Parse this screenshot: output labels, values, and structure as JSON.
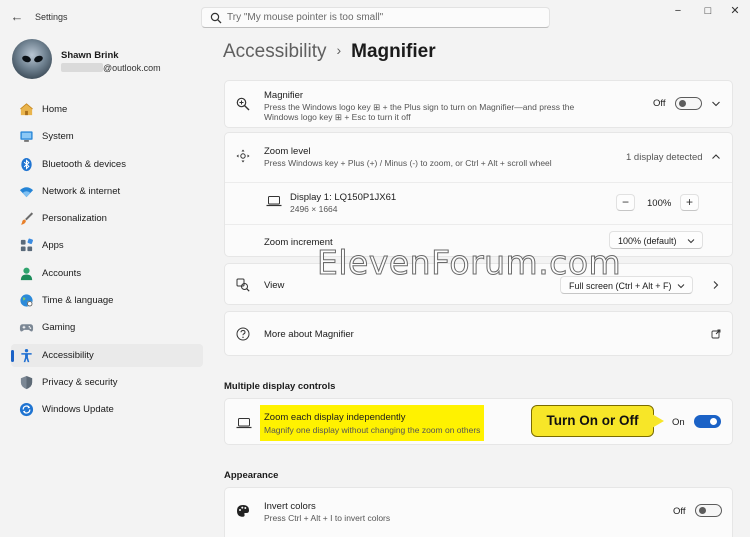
{
  "window": {
    "back_icon": "back-arrow-icon",
    "app_title": "Settings",
    "minimize_glyph": "−",
    "maximize_glyph": "□",
    "close_glyph": "✕"
  },
  "search": {
    "placeholder": "Try \"My mouse pointer is too small\""
  },
  "profile": {
    "name": "Shawn Brink",
    "email_suffix": "@outlook.com"
  },
  "sidebar": {
    "items": [
      {
        "label": "Home",
        "icon": "home-icon"
      },
      {
        "label": "System",
        "icon": "system-icon"
      },
      {
        "label": "Bluetooth & devices",
        "icon": "bluetooth-icon"
      },
      {
        "label": "Network & internet",
        "icon": "wifi-icon"
      },
      {
        "label": "Personalization",
        "icon": "brush-icon"
      },
      {
        "label": "Apps",
        "icon": "apps-icon"
      },
      {
        "label": "Accounts",
        "icon": "accounts-icon"
      },
      {
        "label": "Time & language",
        "icon": "globe-icon"
      },
      {
        "label": "Gaming",
        "icon": "gamepad-icon"
      },
      {
        "label": "Accessibility",
        "icon": "accessibility-icon",
        "active": true
      },
      {
        "label": "Privacy & security",
        "icon": "shield-icon"
      },
      {
        "label": "Windows Update",
        "icon": "update-icon"
      }
    ]
  },
  "breadcrumb": {
    "parent": "Accessibility",
    "separator": "›",
    "current": "Magnifier"
  },
  "magnifier": {
    "title": "Magnifier",
    "desc_line1": "Press the Windows logo key ⊞ + the Plus sign to turn on Magnifier—and press the",
    "desc_line2": "Windows logo key ⊞ + Esc to turn it off",
    "state": "Off",
    "toggle_on": false
  },
  "zoom_level": {
    "title": "Zoom level",
    "desc": "Press Windows key + Plus (+) / Minus (-) to zoom, or Ctrl + Alt + scroll wheel",
    "detected": "1 display detected"
  },
  "display": {
    "name": "Display 1: LQ150P1JX61",
    "resolution": "2496 × 1664",
    "minus": "−",
    "zoom_value": "100%",
    "plus": "+"
  },
  "zoom_increment": {
    "label": "Zoom increment",
    "value": "100% (default)"
  },
  "view": {
    "title": "View",
    "value": "Full screen (Ctrl + Alt + F)"
  },
  "more_about": {
    "title": "More about Magnifier"
  },
  "multiple_display": {
    "heading": "Multiple display controls",
    "title": "Zoom each display independently",
    "desc": "Magnify one display without changing the zoom on others",
    "state": "On",
    "toggle_on": true
  },
  "callout": {
    "text": "Turn On or Off"
  },
  "appearance": {
    "heading": "Appearance",
    "invert_title": "Invert colors",
    "invert_desc": "Press Ctrl + Alt + I to invert colors",
    "state": "Off",
    "toggle_on": false
  },
  "watermark": {
    "text": "ElevenForum.com"
  },
  "colors": {
    "accent": "#1b62c6",
    "highlight": "#fff200",
    "callout": "#f7e628"
  }
}
